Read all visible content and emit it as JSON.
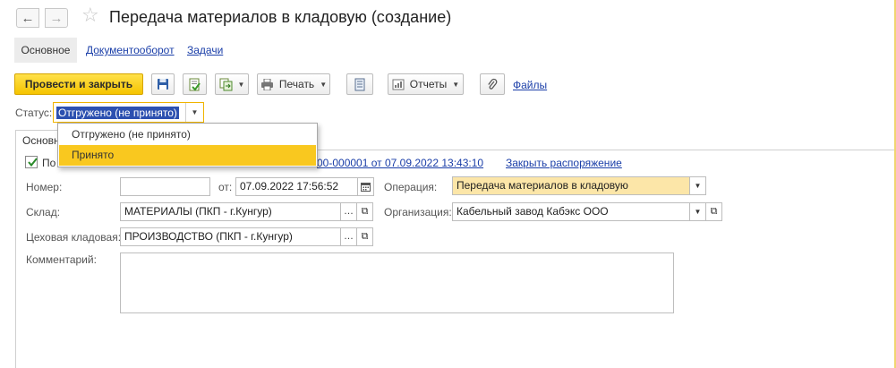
{
  "window": {
    "title": "Передача материалов в кладовую (создание)"
  },
  "nav": {
    "back_icon": "arrow-left-icon",
    "forward_icon": "arrow-right-icon",
    "favorite_icon": "star-icon"
  },
  "form_tabs": [
    {
      "label": "Основное"
    },
    {
      "label": "Документооборот"
    },
    {
      "label": "Задачи"
    }
  ],
  "toolbar": {
    "post_close_label": "Провести и закрыть",
    "print_label": "Печать",
    "reports_label": "Отчеты",
    "files_label": "Файлы"
  },
  "status": {
    "label": "Статус:",
    "value": "Отгружено (не принято)",
    "options": [
      "Отгружено (не принято)",
      "Принято"
    ],
    "highlighted_option": "Принято"
  },
  "panel": {
    "tab_label": "Основн",
    "checkbox_label": "По",
    "checkbox_checked": true,
    "doc_link": "00-000001 от 07.09.2022 13:43:10",
    "close_order_link": "Закрыть распоряжение"
  },
  "fields": {
    "number_label": "Номер:",
    "number_value": "",
    "date_label": "от:",
    "date_value": "07.09.2022 17:56:52",
    "operation_label": "Операция:",
    "operation_value": "Передача материалов в кладовую",
    "warehouse_label": "Склад:",
    "warehouse_value": "МАТЕРИАЛЫ (ПКП - г.Кунгур)",
    "organization_label": "Организация:",
    "organization_value": "Кабельный завод Кабэкс ООО",
    "shop_storage_label": "Цеховая кладовая:",
    "shop_storage_value": "ПРОИЗВОДСТВО (ПКП - г.Кунгур)",
    "comment_label": "Комментарий:",
    "comment_value": ""
  },
  "colors": {
    "accent_yellow": "#f5c400",
    "link_blue": "#1a3ea8",
    "selection_blue": "#2c50b0",
    "highlight_field": "#fce6a8"
  }
}
